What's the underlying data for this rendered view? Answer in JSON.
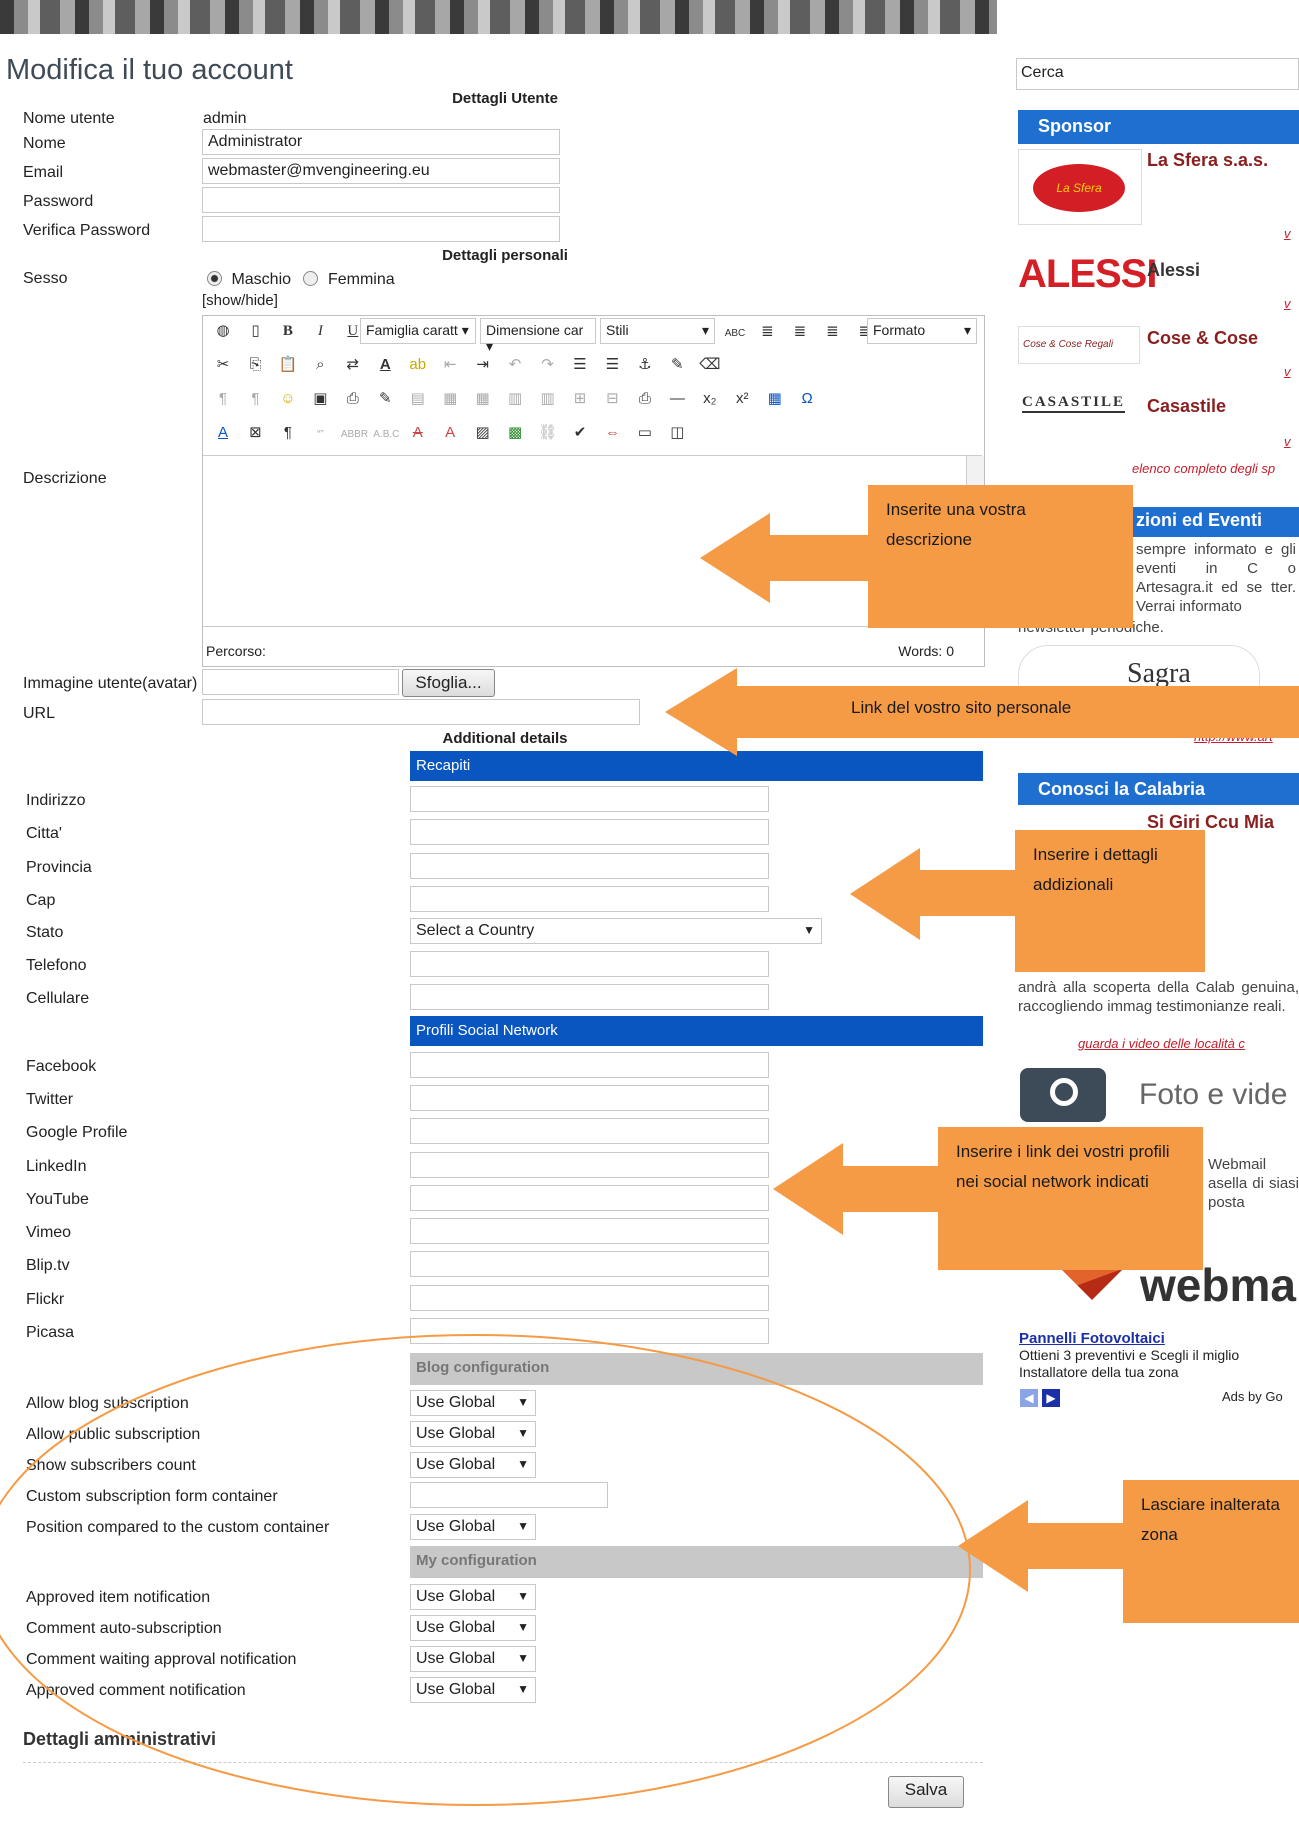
{
  "page": {
    "title": "Modifica il tuo account",
    "section_user": "Dettagli Utente",
    "section_personal": "Dettagli personali",
    "section_additional": "Additional details",
    "section_admin": "Dettagli amministrativi"
  },
  "user": {
    "username_label": "Nome utente",
    "username_value": "admin",
    "name_label": "Nome",
    "name_value": "Administrator",
    "email_label": "Email",
    "email_value": "webmaster@mvengineering.eu",
    "password_label": "Password",
    "verify_label": "Verifica Password"
  },
  "personal": {
    "sex_label": "Sesso",
    "male": "Maschio",
    "female": "Femmina",
    "selected": "Maschio",
    "showhide": "[show/hide]",
    "description_label": "Descrizione",
    "path_label": "Percorso:",
    "words_label": "Words: 0",
    "avatar_label": "Immagine utente(avatar)",
    "browse_button": "Sfoglia...",
    "url_label": "URL"
  },
  "editor": {
    "font_family": "Famiglia caratt",
    "font_size": "Dimensione car",
    "styles": "Stili",
    "format": "Formato"
  },
  "recapiti": {
    "header": "Recapiti",
    "fields": [
      "Indirizzo",
      "Citta'",
      "Provincia",
      "Cap",
      "Stato",
      "Telefono",
      "Cellulare"
    ],
    "country_placeholder": "Select a Country"
  },
  "social": {
    "header": "Profili Social Network",
    "fields": [
      "Facebook",
      "Twitter",
      "Google Profile",
      "LinkedIn",
      "YouTube",
      "Vimeo",
      "Blip.tv",
      "Flickr",
      "Picasa"
    ]
  },
  "blog": {
    "header": "Blog configuration",
    "rows": [
      {
        "label": "Allow blog subscription",
        "value": "Use Global"
      },
      {
        "label": "Allow public subscription",
        "value": "Use Global"
      },
      {
        "label": "Show subscribers count",
        "value": "Use Global"
      },
      {
        "label": "Custom subscription form container",
        "value": ""
      },
      {
        "label": "Position compared to the custom container",
        "value": "Use Global"
      }
    ]
  },
  "myconfig": {
    "header": "My configuration",
    "rows": [
      {
        "label": "Approved item notification",
        "value": "Use Global"
      },
      {
        "label": "Comment auto-subscription",
        "value": "Use Global"
      },
      {
        "label": "Comment waiting approval notification",
        "value": "Use Global"
      },
      {
        "label": "Approved comment notification",
        "value": "Use Global"
      }
    ]
  },
  "save_button": "Salva",
  "sidebar": {
    "search_label": "Cerca",
    "sponsor_header": "Sponsor",
    "sponsors": [
      "La Sfera s.a.s.",
      "Alessi",
      "Cose & Cose",
      "Casastile"
    ],
    "sponsor_logos": [
      "La Sfera",
      "ALESSI",
      "Cose & Cose Regali",
      "CASASTILE"
    ],
    "sponsor_more": "v",
    "sponsor_list_link": "elenco completo degli sp",
    "events_header": "zioni ed Eventi",
    "events_text": "sempre informato e gli eventi in C o Artesagra.it ed se tter. Verrai informato",
    "events_text_tail": "newsletter periodiche.",
    "artesagra_logo": "Sagra",
    "artesagra_link": "http://www.art",
    "calabria_header": "Conosci la Calabria",
    "calabria_title": "Si Giri Ccu Mia",
    "calabria_text": "andrà alla scoperta della Calab genuina, raccogliendo immag testimonianze reali.",
    "calabria_link": "guarda i video delle località c",
    "foto_label": "Foto e vide",
    "webmail_text": "Webmail asella di siasi posta",
    "webmail_logo": "webma",
    "ad_title": "Pannelli Fotovoltaici",
    "ad_text": "Ottieni 3 preventivi e Scegli il miglio Installatore della tua zona",
    "ads_by": "Ads by Go"
  },
  "callouts": {
    "description": "Inserite una vostra descrizione",
    "url": "Link del vostro sito personale",
    "additional": "Inserire i dettagli addizionali",
    "social": "Inserire i link dei vostri profili nei social network indicati",
    "leave": "Lasciare inalterata zona"
  },
  "colors": {
    "accent_orange": "#f59a45",
    "section_blue": "#0a56c0",
    "sidebar_blue": "#1f6fd1",
    "grey_bar": "#c8c8c8"
  }
}
